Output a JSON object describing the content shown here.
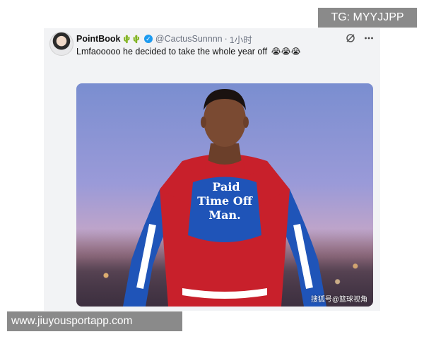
{
  "tweet": {
    "display_name": "PointBook",
    "name_emojis": "🌵🌵",
    "handle": "@CactusSunnnn",
    "separator": "·",
    "time": "1小时",
    "text": "Lmfaooooo he decided to take the whole  year off",
    "text_emojis": "😭😭😭",
    "verified_glyph": "✓",
    "grok_icon": "grok-icon",
    "more_icon": "more-icon"
  },
  "media": {
    "shirt_text": [
      "Paid",
      "Time Off",
      "Man."
    ],
    "source_watermark": "搜狐号@篮球视角"
  },
  "overlays": {
    "top_right": "TG: MYYJJPP",
    "bottom_left": "www.jiuyousportapp.com"
  },
  "colors": {
    "verified": "#1d9bf0",
    "suit_red": "#c8202b",
    "suit_blue": "#1f54b8",
    "overlay_gray": "#8a8a8a"
  }
}
